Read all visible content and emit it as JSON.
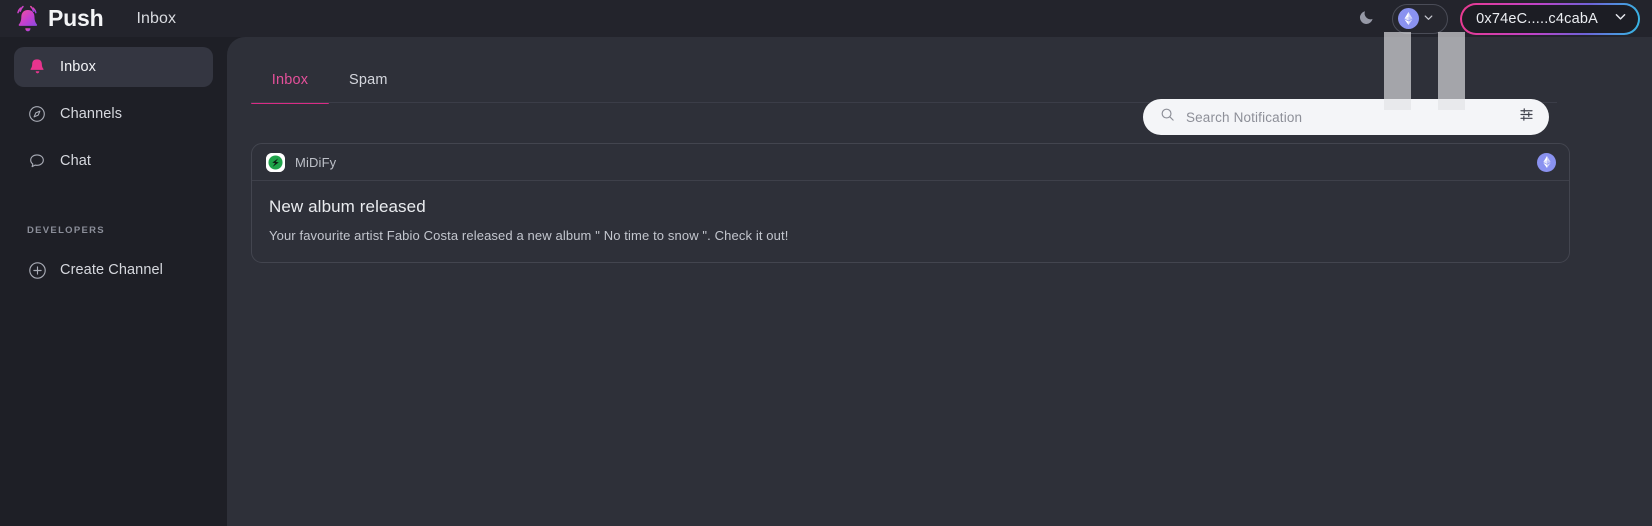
{
  "topbar": {
    "logo_icon": "bell-logo-icon",
    "brand": "Push",
    "page_title": "Inbox",
    "theme_toggle_icon": "moon-icon",
    "chain_selector": {
      "icon": "ethereum-icon",
      "chevron_icon": "chevron-down-icon"
    },
    "wallet": {
      "address": "0x74eC.....c4cabA",
      "chevron_icon": "chevron-down-icon",
      "border_gradient_from": "#ea3a8f",
      "border_gradient_to": "#35b9e4"
    }
  },
  "sidebar": {
    "items": [
      {
        "label": "Inbox",
        "icon": "bell-icon",
        "active": true
      },
      {
        "label": "Channels",
        "icon": "compass-icon",
        "active": false
      },
      {
        "label": "Chat",
        "icon": "chat-bubble-icon",
        "active": false
      }
    ],
    "section_header": "DEVELOPERS",
    "developer_items": [
      {
        "label": "Create Channel",
        "icon": "plus-circle-icon"
      }
    ],
    "active_accent": "#e4509a"
  },
  "main": {
    "tabs": [
      {
        "label": "Inbox",
        "active": true
      },
      {
        "label": "Spam",
        "active": false
      }
    ],
    "tab_accent": "#d92b85",
    "search": {
      "placeholder": "Search Notification",
      "value": "",
      "search_icon": "search-icon",
      "filter_icon": "sliders-filter-icon"
    },
    "notifications": [
      {
        "app_name": "MiDiFy",
        "app_avatar_icon": "midify-logo-icon",
        "chain_icon": "ethereum-icon",
        "title": "New album released",
        "body": "Your favourite artist Fabio Costa released a new album \" No time to snow \". Check it out!"
      }
    ]
  },
  "colors": {
    "sidebar_bg": "#1e1f26",
    "main_bg": "#2e3039",
    "topbar_bg": "#23242c",
    "accent_pink": "#d92b85",
    "chain_badge": "#8a92f0"
  }
}
